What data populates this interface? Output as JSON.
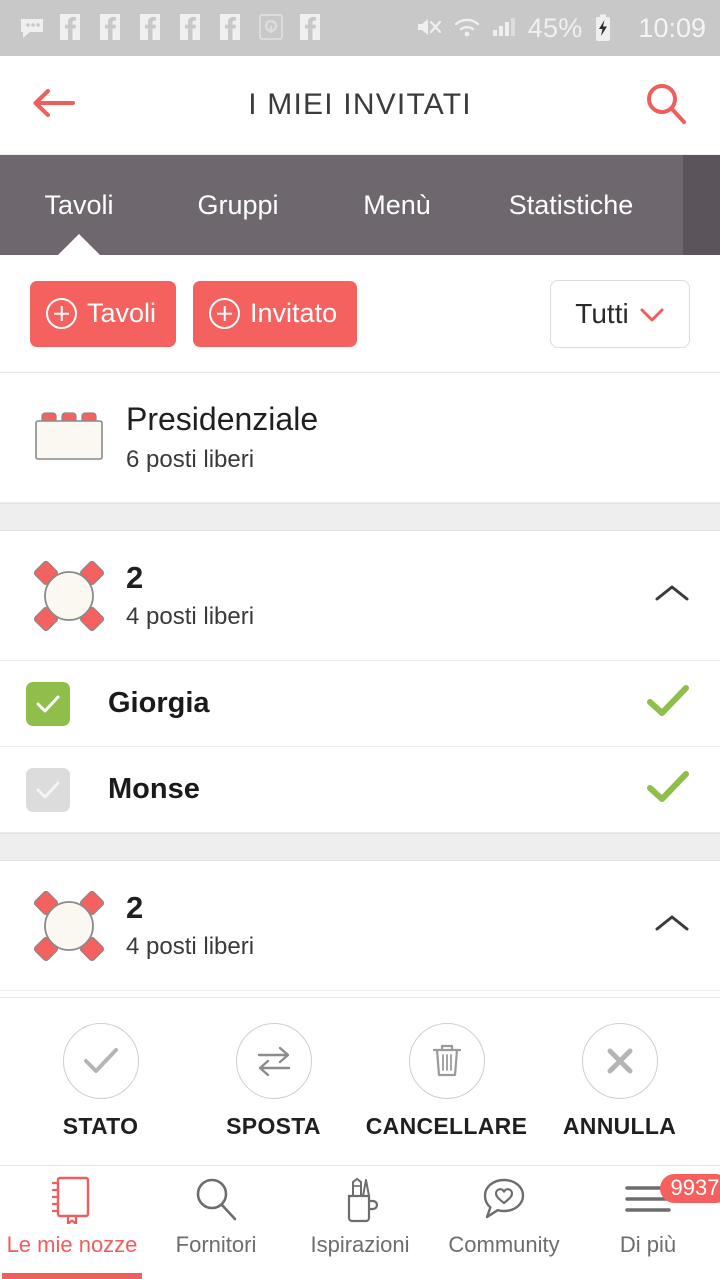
{
  "statusbar": {
    "notification_icons": [
      "messages-icon",
      "facebook-icon",
      "facebook-icon",
      "facebook-icon",
      "facebook-icon",
      "facebook-icon",
      "app-circle-icon",
      "facebook-icon"
    ],
    "mute_icon": "mute-icon",
    "wifi_icon": "wifi-icon",
    "signal_icon": "signal-icon",
    "battery_percent": "45%",
    "battery_icon": "battery-charging-icon",
    "time": "10:09"
  },
  "header": {
    "back_icon": "back-arrow-icon",
    "title": "I MIEI INVITATI",
    "search_icon": "search-icon"
  },
  "tabs": [
    {
      "label": "Tavoli",
      "active": true
    },
    {
      "label": "Gruppi",
      "active": false
    },
    {
      "label": "Menù",
      "active": false
    },
    {
      "label": "Statistiche",
      "active": false
    }
  ],
  "actions": {
    "add_table_label": "Tavoli",
    "add_guest_label": "Invitato",
    "filter_value": "Tutti",
    "filter_chevron": "chevron-down-icon"
  },
  "tables": [
    {
      "icon": "rectangular-table-icon",
      "name": "Presidenziale",
      "seats": "6 posti liberi",
      "expand_icon": null,
      "guests": []
    },
    {
      "icon": "round-table-icon",
      "name": "2",
      "seats": "4 posti liberi",
      "expand_icon": "chevron-up-icon",
      "guests": [
        {
          "name": "Giorgia",
          "checkbox_state": "checked",
          "status_icon": "green-check-icon"
        },
        {
          "name": "Monse",
          "checkbox_state": "unchecked",
          "status_icon": "green-check-icon"
        }
      ]
    },
    {
      "icon": "round-table-icon",
      "name": "2",
      "seats": "4 posti liberi",
      "expand_icon": "chevron-up-icon",
      "guests": []
    }
  ],
  "action_bar": [
    {
      "label": "STATO",
      "icon": "check-circle-icon"
    },
    {
      "label": "SPOSTA",
      "icon": "swap-arrows-icon"
    },
    {
      "label": "CANCELLARE",
      "icon": "trash-icon"
    },
    {
      "label": "ANNULLA",
      "icon": "close-x-icon"
    }
  ],
  "bottom_nav": [
    {
      "label": "Le mie nozze",
      "icon": "book-icon",
      "active": true,
      "badge": null
    },
    {
      "label": "Fornitori",
      "icon": "search-icon",
      "active": false,
      "badge": null
    },
    {
      "label": "Ispirazioni",
      "icon": "pencil-cup-icon",
      "active": false,
      "badge": null
    },
    {
      "label": "Community",
      "icon": "speech-heart-icon",
      "active": false,
      "badge": null
    },
    {
      "label": "Di più",
      "icon": "hamburger-icon",
      "active": false,
      "badge": "9937"
    }
  ],
  "colors": {
    "accent": "#f4615f",
    "tabbar": "#6e676d",
    "green": "#8fbe4b",
    "statusbar": "#c8c8c8"
  }
}
